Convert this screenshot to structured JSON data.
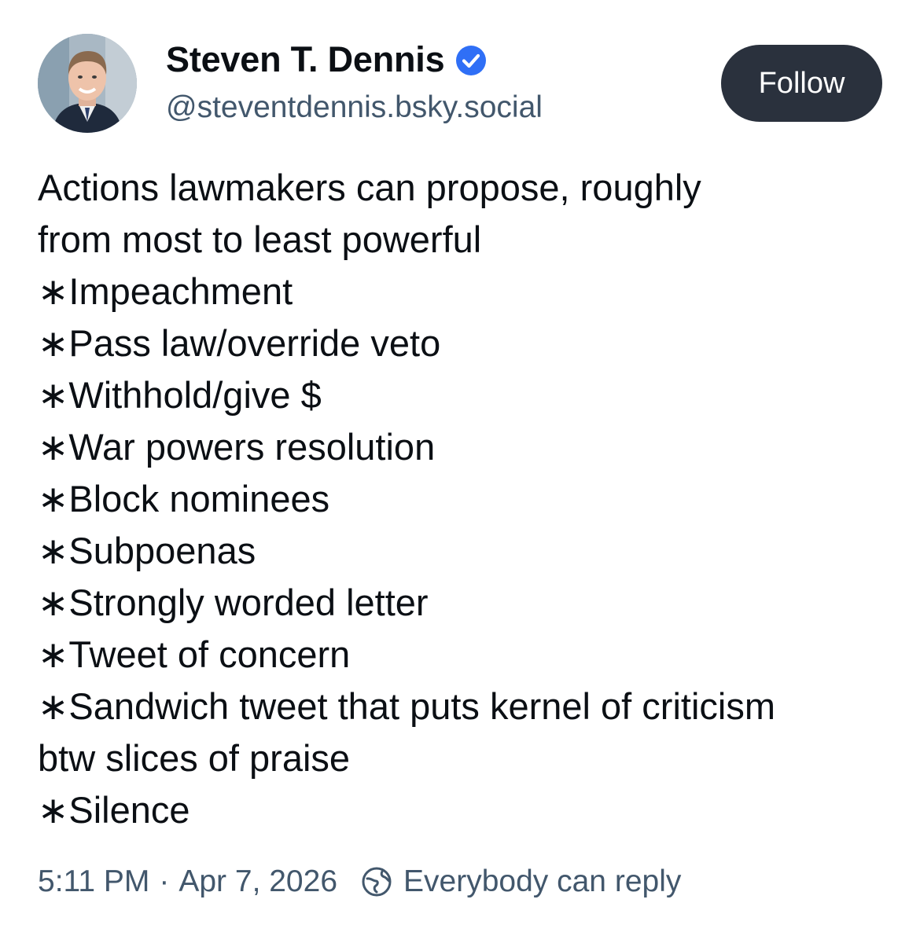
{
  "author": {
    "display_name": "Steven T. Dennis",
    "handle": "@steventdennis.bsky.social",
    "verified_icon": "verified-badge-icon",
    "verified_color": "#2f6ff6"
  },
  "follow_button": {
    "label": "Follow",
    "bg_color": "#2a313d"
  },
  "post": {
    "lines": [
      "Actions lawmakers can propose, roughly",
      "from most to least powerful",
      "∗Impeachment",
      "∗Pass law/override veto",
      "∗Withhold/give $",
      "∗War powers resolution",
      "∗Block nominees",
      "∗Subpoenas",
      "∗Strongly worded letter",
      "∗Tweet of concern",
      "∗Sandwich tweet that puts kernel of criticism",
      "btw slices of praise",
      "∗Silence"
    ]
  },
  "meta": {
    "time": "5:11 PM",
    "separator": "·",
    "date": "Apr 7, 2026",
    "reply_icon": "globe-reply-icon",
    "reply_setting": "Everybody can reply"
  }
}
